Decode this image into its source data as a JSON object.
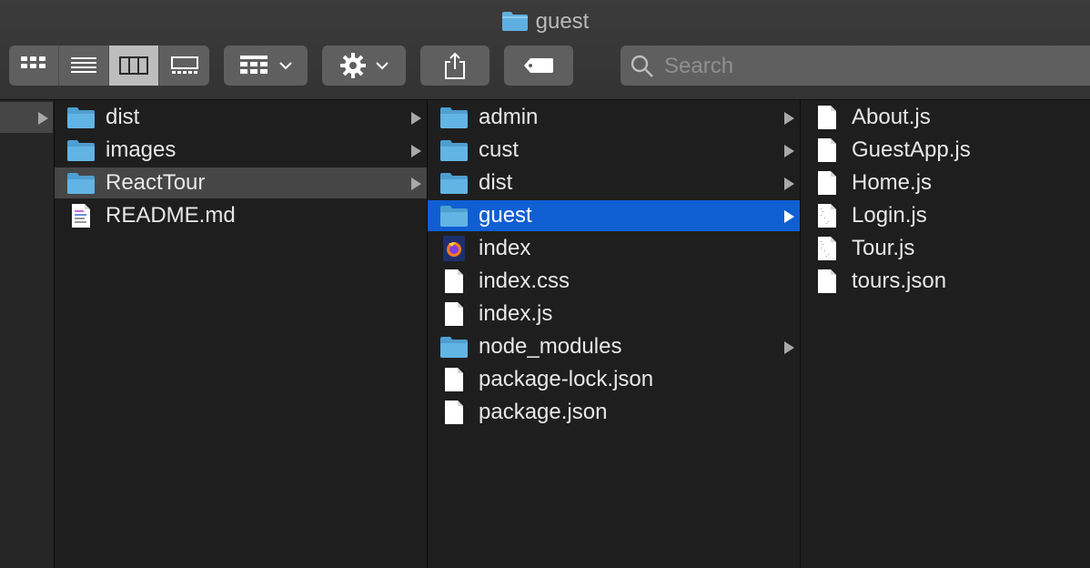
{
  "window": {
    "title": "guest"
  },
  "toolbar": {
    "view_modes": [
      "icon-view",
      "list-view",
      "column-view",
      "gallery-view"
    ],
    "active_view": "column-view",
    "group_button": "group-by-icon",
    "action_button": "gear-icon",
    "share_button": "share-icon",
    "tag_button": "tag-icon",
    "search_placeholder": "Search"
  },
  "columns": {
    "col1": [
      {
        "label": "dist",
        "kind": "folder",
        "arrow": true
      },
      {
        "label": "images",
        "kind": "folder",
        "arrow": true
      },
      {
        "label": "ReactTour",
        "kind": "folder",
        "arrow": true,
        "selected": "grey"
      },
      {
        "label": "README.md",
        "kind": "markdown",
        "arrow": false
      }
    ],
    "col2": [
      {
        "label": "admin",
        "kind": "folder",
        "arrow": true
      },
      {
        "label": "cust",
        "kind": "folder",
        "arrow": true
      },
      {
        "label": "dist",
        "kind": "folder",
        "arrow": true
      },
      {
        "label": "guest",
        "kind": "folder",
        "arrow": true,
        "selected": "blue"
      },
      {
        "label": "index",
        "kind": "firefox",
        "arrow": false
      },
      {
        "label": "index.css",
        "kind": "file",
        "arrow": false
      },
      {
        "label": "index.js",
        "kind": "file",
        "arrow": false
      },
      {
        "label": "node_modules",
        "kind": "folder",
        "arrow": true
      },
      {
        "label": "package-lock.json",
        "kind": "file",
        "arrow": false
      },
      {
        "label": "package.json",
        "kind": "file",
        "arrow": false
      }
    ],
    "col3": [
      {
        "label": "About.js",
        "kind": "file",
        "arrow": false
      },
      {
        "label": "GuestApp.js",
        "kind": "file",
        "arrow": false
      },
      {
        "label": "Home.js",
        "kind": "file",
        "arrow": false
      },
      {
        "label": "Login.js",
        "kind": "file-dotted",
        "arrow": false
      },
      {
        "label": "Tour.js",
        "kind": "file-dotted",
        "arrow": false
      },
      {
        "label": "tours.json",
        "kind": "file",
        "arrow": false
      }
    ]
  },
  "colors": {
    "folder": "#5fb0e0",
    "selection": "#0f5fd3"
  }
}
